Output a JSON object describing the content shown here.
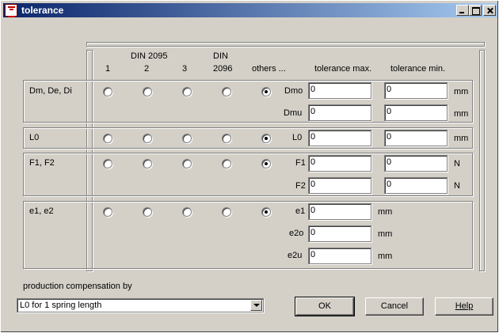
{
  "window": {
    "title": "tolerance"
  },
  "headers": {
    "din2095": "DIN 2095",
    "din2096_l1": "DIN",
    "din2096_l2": "2096",
    "col1": "1",
    "col2": "2",
    "col3": "3",
    "others": "others ...",
    "tol_max": "tolerance max.",
    "tol_min": "tolerance min."
  },
  "groups": [
    {
      "label": "Dm, De, Di",
      "rows": [
        {
          "name": "Dmo",
          "max": "0",
          "min": "0",
          "unit": "mm"
        },
        {
          "name": "Dmu",
          "max": "0",
          "min": "0",
          "unit": "mm"
        }
      ]
    },
    {
      "label": "L0",
      "rows": [
        {
          "name": "L0",
          "max": "0",
          "min": "0",
          "unit": "mm"
        }
      ]
    },
    {
      "label": "F1, F2",
      "rows": [
        {
          "name": "F1",
          "max": "0",
          "min": "0",
          "unit": "N"
        },
        {
          "name": "F2",
          "max": "0",
          "min": "0",
          "unit": "N"
        }
      ]
    },
    {
      "label": "e1, e2",
      "rows": [
        {
          "name": "e1",
          "max": "0",
          "unit": "mm"
        },
        {
          "name": "e2o",
          "max": "0",
          "unit": "mm"
        },
        {
          "name": "e2u",
          "max": "0",
          "unit": "mm"
        }
      ]
    }
  ],
  "selected_option": "others ...",
  "compensation": {
    "label": "production compensation by",
    "value": "L0 for 1 spring length"
  },
  "buttons": {
    "ok": "OK",
    "cancel": "Cancel",
    "help": "Help"
  }
}
